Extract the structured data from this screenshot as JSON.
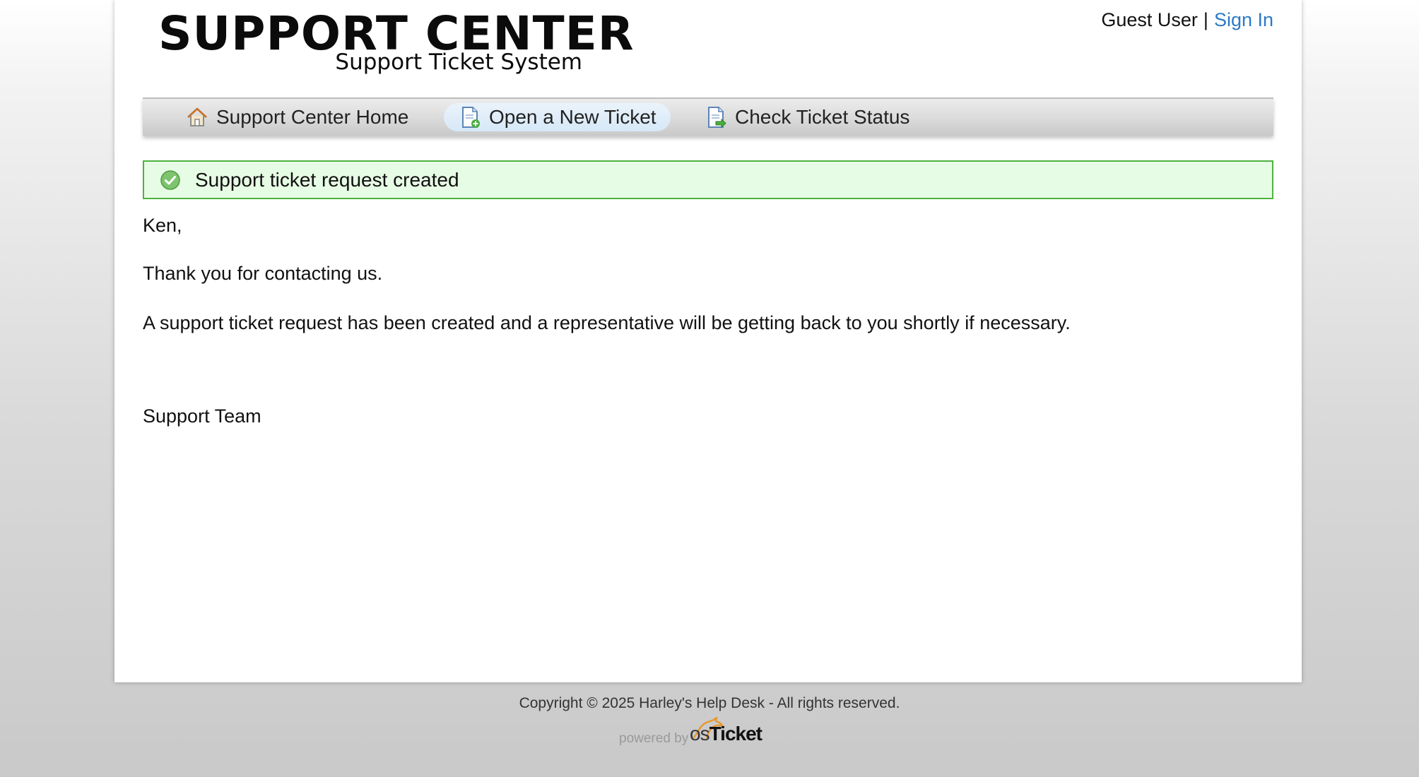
{
  "header": {
    "logo_title": "SUPPORT CENTER",
    "logo_subtitle": "Support Ticket System",
    "user_label": "Guest User",
    "separator": "|",
    "sign_in_label": "Sign In"
  },
  "nav": {
    "items": [
      {
        "label": "Support Center Home",
        "icon": "home-icon",
        "active": false
      },
      {
        "label": "Open a New Ticket",
        "icon": "new-ticket-icon",
        "active": true
      },
      {
        "label": "Check Ticket Status",
        "icon": "ticket-status-icon",
        "active": false
      }
    ]
  },
  "notice": {
    "icon": "success-check-icon",
    "message": "Support ticket request created"
  },
  "content": {
    "greeting": "Ken,",
    "thanks": "Thank you for contacting us.",
    "body": "A support ticket request has been created and a representative will be getting back to you shortly if necessary.",
    "signature": "Support Team"
  },
  "footer": {
    "copyright": "Copyright © 2025 Harley's Help Desk - All rights reserved.",
    "powered_by": "powered by",
    "brand_prefix": "os",
    "brand_name": "Ticket"
  },
  "colors": {
    "link": "#2c7ac7",
    "notice_bg": "#e7fce4",
    "notice_border": "#4eb340",
    "active_tab": "#d6e8f7"
  }
}
